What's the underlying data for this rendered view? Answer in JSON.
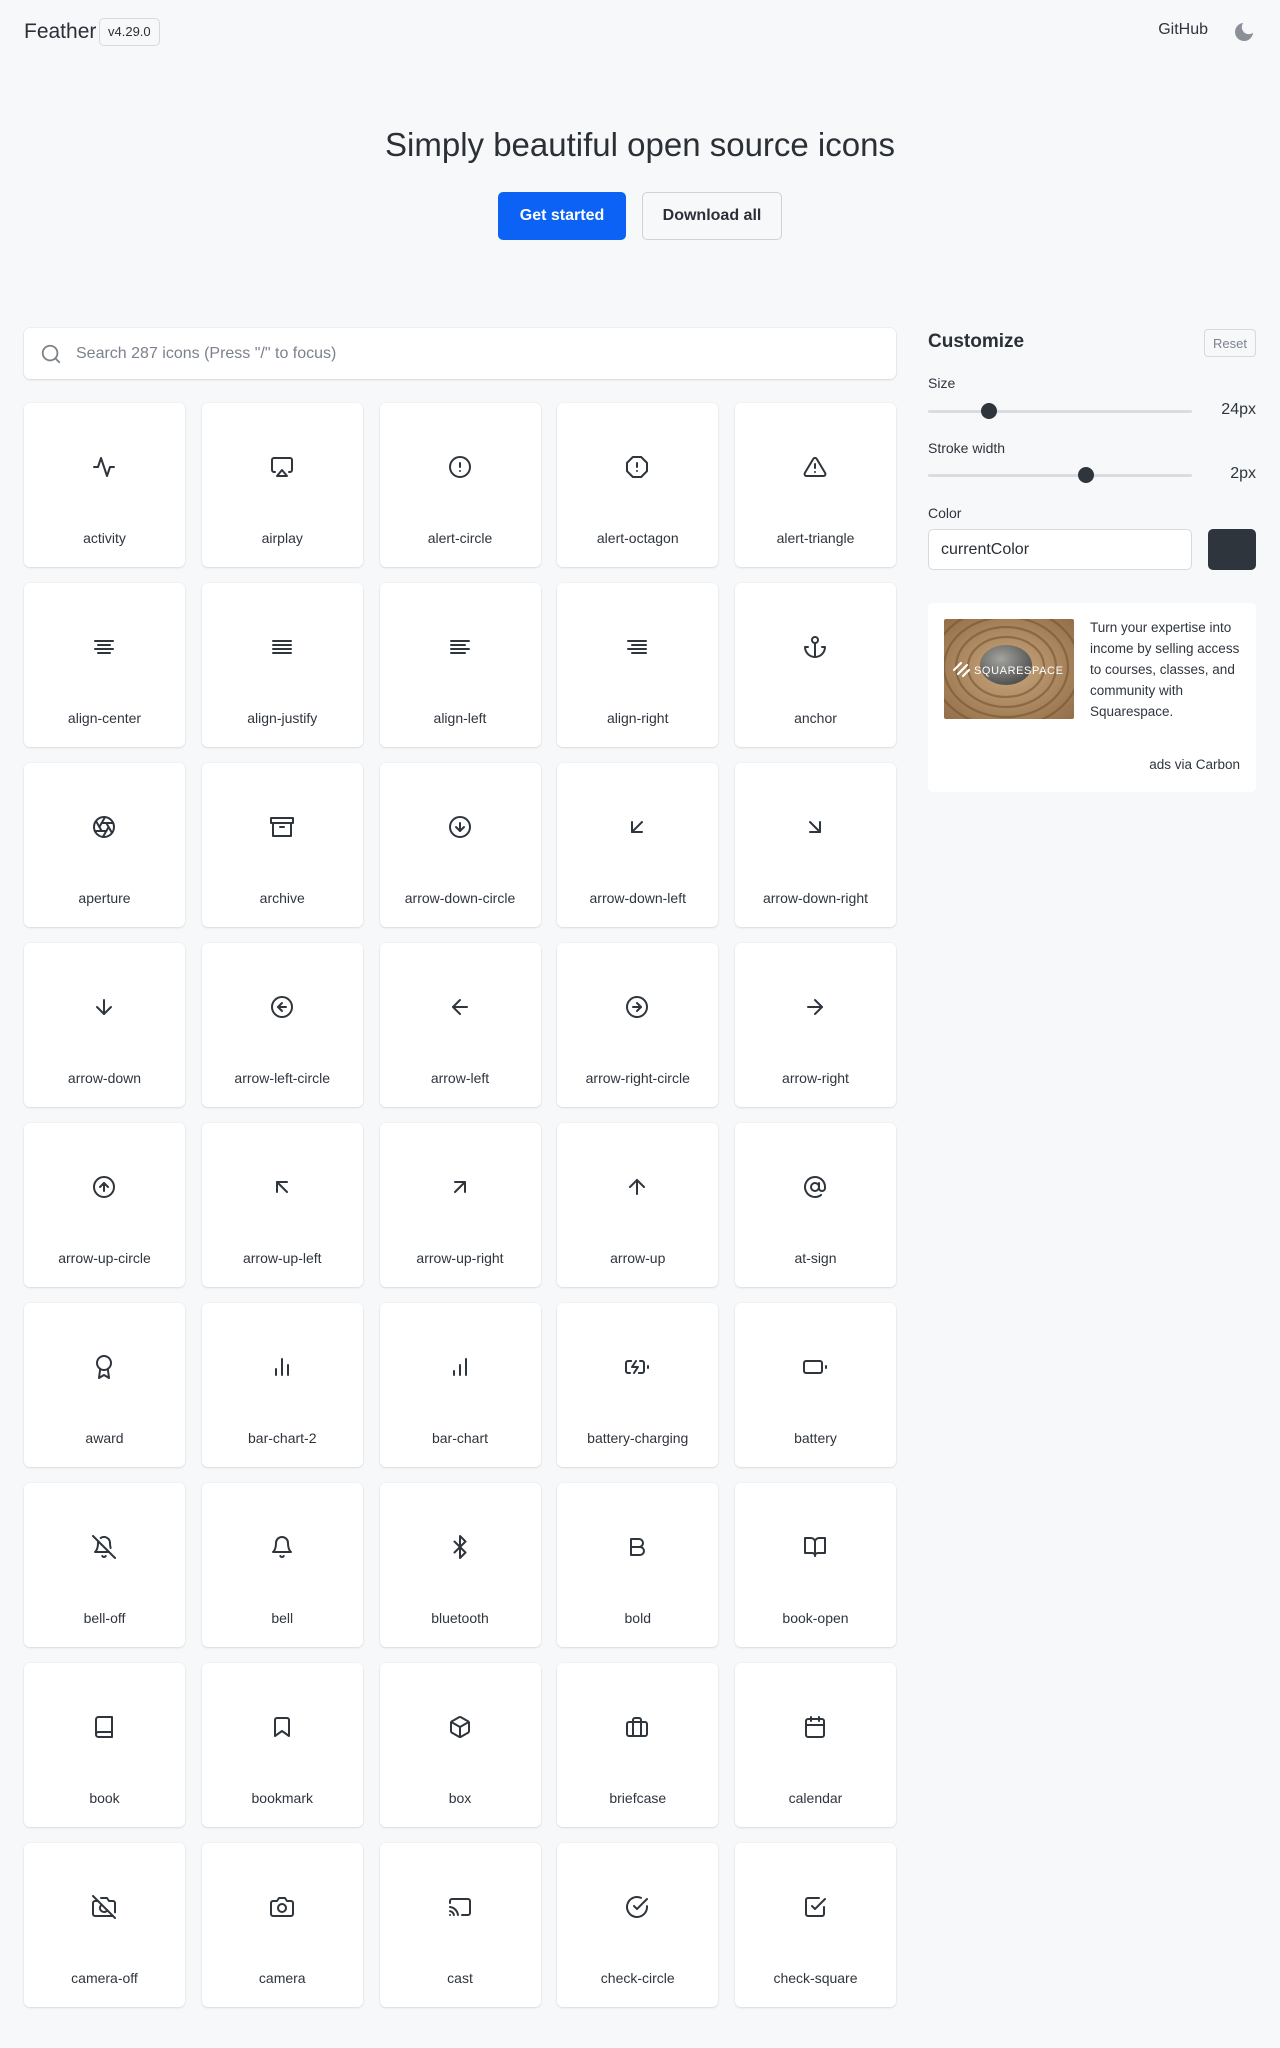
{
  "header": {
    "brand": "Feather",
    "version": "v4.29.0",
    "github_label": "GitHub",
    "theme_icon": "moon-icon"
  },
  "hero": {
    "title": "Simply beautiful open source icons",
    "primary_button": "Get started",
    "secondary_button": "Download all"
  },
  "colors": {
    "accent": "#0b62f5",
    "icon_color": "#2f353d",
    "background": "#f7f8fa"
  },
  "search": {
    "icon": "search-icon",
    "placeholder": "Search 287 icons (Press \"/\" to focus)",
    "value": ""
  },
  "icons": [
    "activity",
    "airplay",
    "alert-circle",
    "alert-octagon",
    "alert-triangle",
    "align-center",
    "align-justify",
    "align-left",
    "align-right",
    "anchor",
    "aperture",
    "archive",
    "arrow-down-circle",
    "arrow-down-left",
    "arrow-down-right",
    "arrow-down",
    "arrow-left-circle",
    "arrow-left",
    "arrow-right-circle",
    "arrow-right",
    "arrow-up-circle",
    "arrow-up-left",
    "arrow-up-right",
    "arrow-up",
    "at-sign",
    "award",
    "bar-chart-2",
    "bar-chart",
    "battery-charging",
    "battery",
    "bell-off",
    "bell",
    "bluetooth",
    "bold",
    "book-open",
    "book",
    "bookmark",
    "box",
    "briefcase",
    "calendar",
    "camera-off",
    "camera",
    "cast",
    "check-circle",
    "check-square"
  ],
  "customize": {
    "title": "Customize",
    "reset_label": "Reset",
    "size": {
      "label": "Size",
      "value": 24,
      "display": "24px",
      "min": 12,
      "max": 64
    },
    "stroke": {
      "label": "Stroke width",
      "value": 2,
      "display": "2px",
      "min": 0.5,
      "max": 3
    },
    "color": {
      "label": "Color",
      "value": "currentColor",
      "swatch": "#2f353d"
    }
  },
  "ad": {
    "brand_mark": "SQUARESPACE",
    "text": "Turn your expertise into income by selling access to courses, classes, and community with Squarespace.",
    "via": "ads via Carbon"
  }
}
